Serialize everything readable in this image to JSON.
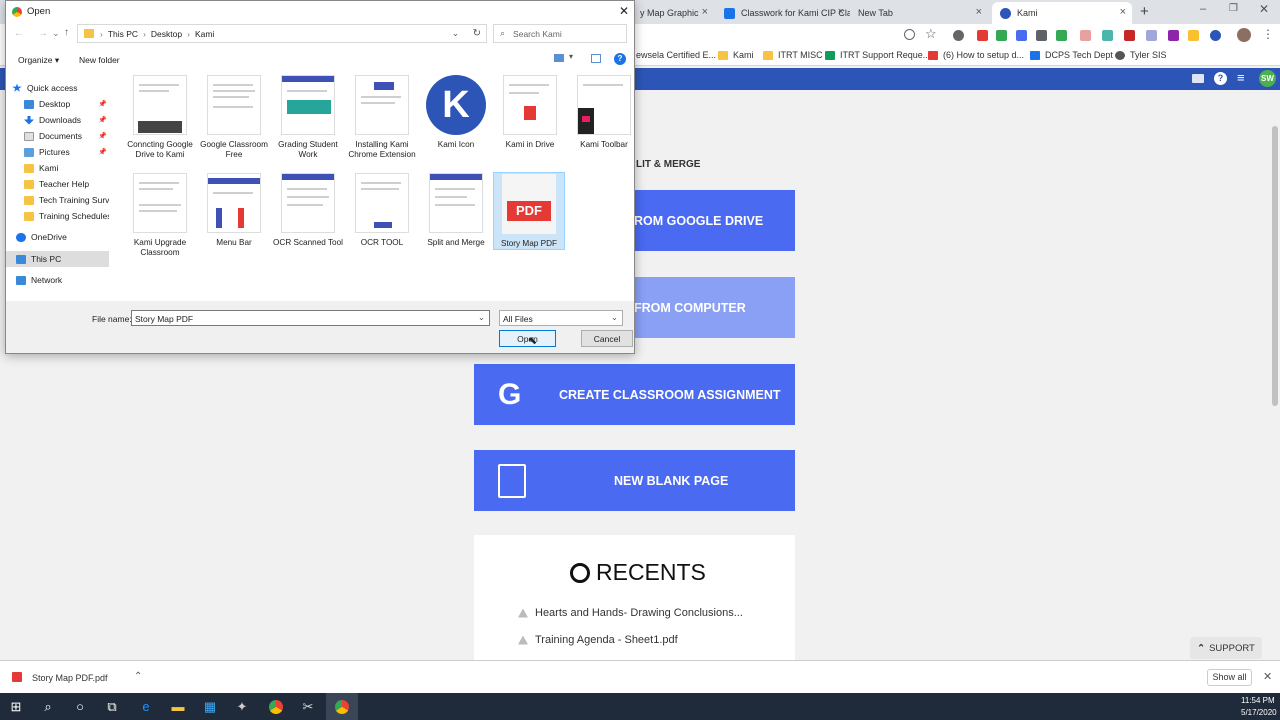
{
  "browser": {
    "tabs": [
      {
        "label": "y Map Graphic"
      },
      {
        "label": "Classwork for Kami CIP Cla"
      },
      {
        "label": "New Tab"
      },
      {
        "label": "Kami"
      }
    ],
    "bookmarks": [
      {
        "label": "ewsela Certified E..."
      },
      {
        "label": "Kami"
      },
      {
        "label": "ITRT MISC"
      },
      {
        "label": "ITRT Support Reque..."
      },
      {
        "label": "(6) How to setup d..."
      },
      {
        "label": "DCPS Tech Dept"
      },
      {
        "label": "Tyler SIS"
      }
    ],
    "profile_initials": "SW"
  },
  "kami": {
    "split_merge_label": "LIT & MERGE",
    "btn_drive": "ROM GOOGLE DRIVE",
    "btn_computer": "FROM COMPUTER",
    "btn_classroom": "CREATE CLASSROOM ASSIGNMENT",
    "btn_blank": "NEW BLANK PAGE",
    "recents_title": "RECENTS",
    "recents": [
      {
        "label": "Hearts and Hands- Drawing Conclusions..."
      },
      {
        "label": "Training Agenda - Sheet1.pdf"
      }
    ],
    "support_label": "SUPPORT"
  },
  "dialog": {
    "title": "Open",
    "breadcrumb": [
      "This PC",
      "Desktop",
      "Kami"
    ],
    "search_placeholder": "Search Kami",
    "organize_label": "Organize",
    "new_folder_label": "New folder",
    "nav": {
      "quick_access": "Quick access",
      "desktop": "Desktop",
      "downloads": "Downloads",
      "documents": "Documents",
      "pictures": "Pictures",
      "kami": "Kami",
      "teacher_help": "Teacher Help",
      "tech_training": "Tech Training Survey",
      "training_schedules": "Training Schedules",
      "onedrive": "OneDrive",
      "this_pc": "This PC",
      "network": "Network"
    },
    "files": [
      {
        "label": "Conncting Google Drive to Kami"
      },
      {
        "label": "Google Classroom Free"
      },
      {
        "label": "Grading Student Work"
      },
      {
        "label": "Installing Kami Chrome Extension"
      },
      {
        "label": "Kami Icon"
      },
      {
        "label": "Kami in Drive"
      },
      {
        "label": "Kami Toolbar"
      },
      {
        "label": "Kami Upgrade Classroom"
      },
      {
        "label": "Menu Bar"
      },
      {
        "label": "OCR Scanned Tool"
      },
      {
        "label": "OCR TOOL"
      },
      {
        "label": "Split and Merge"
      },
      {
        "label": "Story Map PDF"
      }
    ],
    "kami_icon_letter": "K",
    "pdf_badge": "PDF",
    "file_name_label": "File name:",
    "file_name_value": "Story Map PDF",
    "file_type": "All Files",
    "open_label": "Open",
    "cancel_label": "Cancel"
  },
  "downloads": {
    "item": "Story Map PDF.pdf",
    "show_all": "Show all"
  },
  "taskbar": {
    "time": "11:54 PM",
    "date": "5/17/2020"
  },
  "colors": {
    "kami_blue": "#4a6af2",
    "kami_nav": "#2d55b7",
    "pdf_red": "#e53935"
  }
}
